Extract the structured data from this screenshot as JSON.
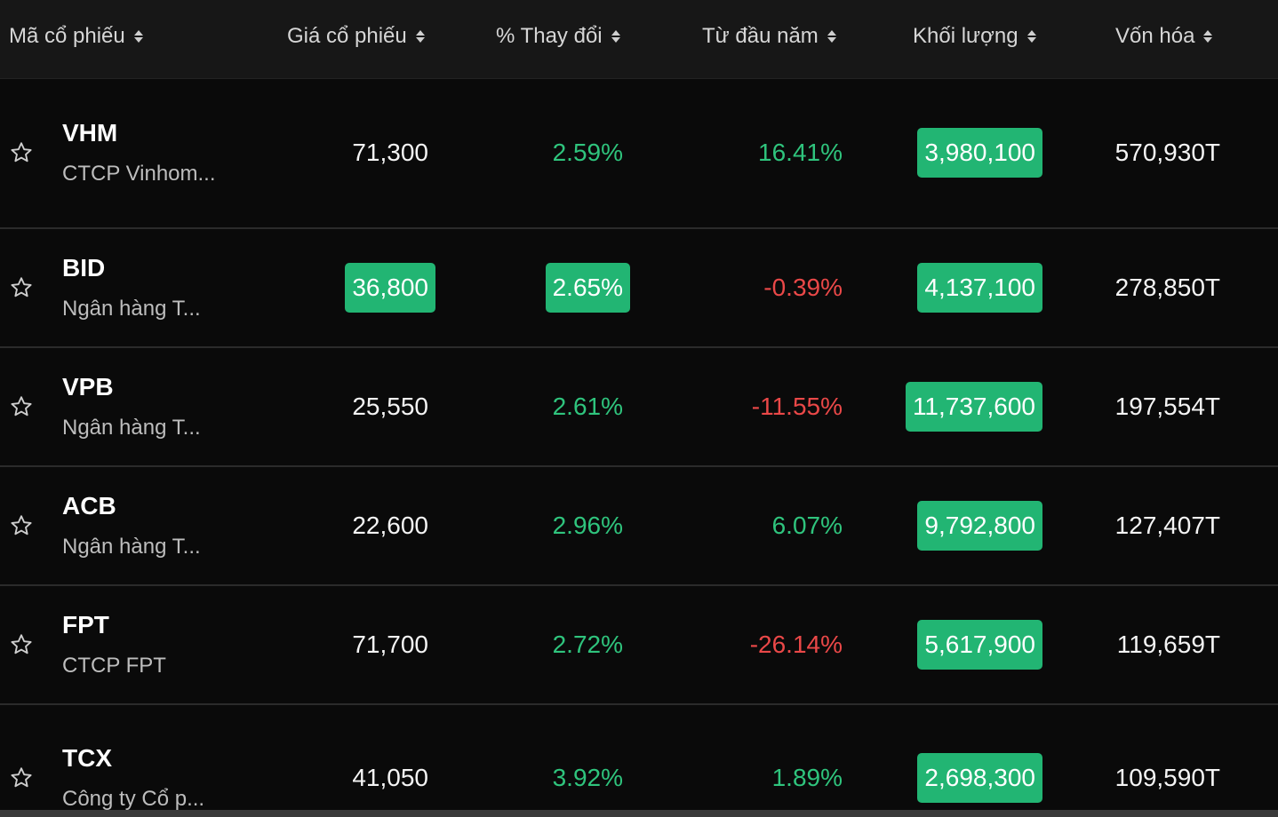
{
  "header": {
    "symbol": "Mã cổ phiếu",
    "price": "Giá cổ phiếu",
    "change": "% Thay đổi",
    "ytd": "Từ đầu năm",
    "volume": "Khối lượng",
    "marketcap": "Vốn hóa"
  },
  "rows": [
    {
      "symbol": "VHM",
      "name": "CTCP Vinhom...",
      "price": "71,300",
      "change": "2.59%",
      "ytd": "16.41%",
      "volume": "3,980,100",
      "marketcap": "570,930T"
    },
    {
      "symbol": "BID",
      "name": "Ngân hàng T...",
      "price": "36,800",
      "change": "2.65%",
      "ytd": "-0.39%",
      "volume": "4,137,100",
      "marketcap": "278,850T"
    },
    {
      "symbol": "VPB",
      "name": "Ngân hàng T...",
      "price": "25,550",
      "change": "2.61%",
      "ytd": "-11.55%",
      "volume": "11,737,600",
      "marketcap": "197,554T"
    },
    {
      "symbol": "ACB",
      "name": "Ngân hàng T...",
      "price": "22,600",
      "change": "2.96%",
      "ytd": "6.07%",
      "volume": "9,792,800",
      "marketcap": "127,407T"
    },
    {
      "symbol": "FPT",
      "name": "CTCP FPT",
      "price": "71,700",
      "change": "2.72%",
      "ytd": "-26.14%",
      "volume": "5,617,900",
      "marketcap": "119,659T"
    },
    {
      "symbol": "TCX",
      "name": "Công ty Cổ p...",
      "price": "41,050",
      "change": "3.92%",
      "ytd": "1.89%",
      "volume": "2,698,300",
      "marketcap": "109,590T"
    }
  ],
  "colors": {
    "up": "#2fc47d",
    "down": "#ea4848",
    "highlight": "#22b573",
    "background": "#0a0a0a",
    "header": "#171717"
  },
  "icons": {
    "star": "star-outline-icon",
    "sort": "sort-icon"
  }
}
